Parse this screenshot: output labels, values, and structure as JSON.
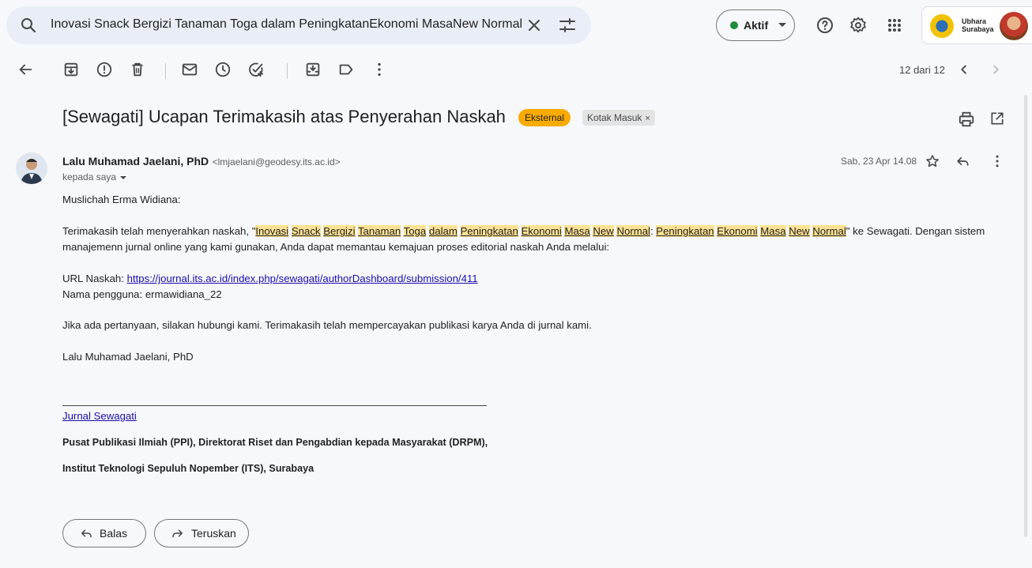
{
  "search": {
    "query": "Inovasi Snack Bergizi Tanaman Toga dalam PeningkatanEkonomi MasaNew Normal: Peningkatan"
  },
  "status": {
    "label": "Aktif"
  },
  "account": {
    "name_line1": "Ubhara",
    "name_line2": "Surabaya"
  },
  "pager": {
    "text": "12 dari 12"
  },
  "subject": {
    "text": "[Sewagati] Ucapan Terimakasih atas Penyerahan Naskah",
    "chip_external": "Eksternal",
    "chip_inbox": "Kotak Masuk",
    "chip_inbox_close": "×"
  },
  "sender": {
    "name": "Lalu Muhamad Jaelani, PhD",
    "email": "<lmjaelani@geodesy.its.ac.id>",
    "to": "kepada saya",
    "date": "Sab, 23 Apr 14.08"
  },
  "body": {
    "greeting": "Muslichah Erma Widiana:",
    "p1_before": "Terimakasih telah menyerahkan naskah, \"",
    "title_words": [
      "Inovasi",
      "Snack",
      "Bergizi",
      "Tanaman",
      "Toga",
      "dalam",
      "Peningkatan",
      "Ekonomi",
      "Masa",
      "New",
      "Normal",
      ":",
      "Peningkatan",
      "Ekonomi",
      "Masa",
      "New",
      "Normal"
    ],
    "p1_after": "\" ke Sewagati. Dengan sistem",
    "p1_line2": "manajemenn jurnal online yang kami gunakan, Anda dapat memantau kemajuan proses editorial naskah Anda melalui:",
    "url_label": "URL Naskah: ",
    "url": "https://journal.its.ac.id/index.php/sewagati/authorDashboard/submission/411",
    "username_line": "Nama pengguna: ermawidiana_22",
    "p3": "Jika ada pertanyaan, silakan hubungi kami. Terimakasih telah mempercayakan publikasi karya Anda di jurnal kami.",
    "signature": "Lalu Muhamad Jaelani, PhD",
    "journal_link": "Jurnal Sewagati",
    "org_line1": "Pusat Publikasi Ilmiah (PPI), Direktorat Riset dan Pengabdian kepada Masyarakat (DRPM),",
    "org_line2": "Institut Teknologi Sepuluh Nopember (ITS), Surabaya"
  },
  "actions": {
    "reply": "Balas",
    "forward": "Teruskan"
  }
}
